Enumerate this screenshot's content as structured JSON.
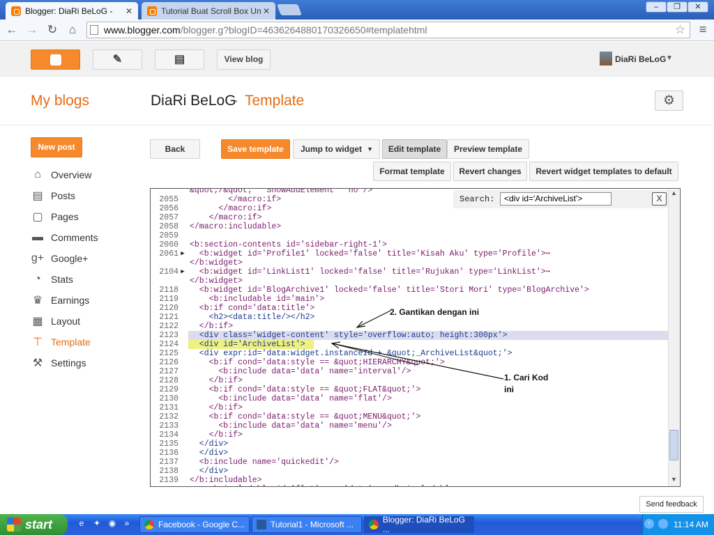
{
  "browser": {
    "tabs": [
      {
        "title": "Blogger: DiaRi BeLoG -",
        "active": true
      },
      {
        "title": "Tutorial Buat Scroll Box Untul",
        "active": false
      }
    ],
    "url_host": "www.blogger.com",
    "url_path": "/blogger.g?blogID=4636264880170326650#templatehtml",
    "window_controls": [
      "–",
      "❐",
      "✕"
    ]
  },
  "blogger_bar": {
    "view_blog": "View blog",
    "user_name": "DiaRi BeLoG"
  },
  "header": {
    "my_blogs": "My blogs",
    "blog_name": "DiaRi BeLoG",
    "separator": "·",
    "section": "Template"
  },
  "sidebar": {
    "new_post": "New post",
    "items": [
      {
        "label": "Overview",
        "icon": "home-icon",
        "glyph": "⌂"
      },
      {
        "label": "Posts",
        "icon": "posts-icon",
        "glyph": "▤"
      },
      {
        "label": "Pages",
        "icon": "pages-icon",
        "glyph": "▢"
      },
      {
        "label": "Comments",
        "icon": "comments-icon",
        "glyph": "▬"
      },
      {
        "label": "Google+",
        "icon": "google-plus-icon",
        "glyph": "g+"
      },
      {
        "label": "Stats",
        "icon": "stats-icon",
        "glyph": "◔"
      },
      {
        "label": "Earnings",
        "icon": "trophy-icon",
        "glyph": "♛"
      },
      {
        "label": "Layout",
        "icon": "layout-icon",
        "glyph": "▦"
      },
      {
        "label": "Template",
        "icon": "template-icon",
        "glyph": "⊤"
      },
      {
        "label": "Settings",
        "icon": "wrench-icon",
        "glyph": "⚒"
      }
    ]
  },
  "actions": {
    "back": "Back",
    "save": "Save template",
    "jump": "Jump to widget",
    "edit": "Edit template",
    "preview": "Preview template",
    "format": "Format template",
    "revert": "Revert changes",
    "revert_widgets": "Revert widget templates to default"
  },
  "editor": {
    "search_label": "Search:",
    "search_value": "<div id='ArchiveList'>",
    "close": "X",
    "lines": [
      {
        "n": "",
        "mark": "",
        "text": "&quot;/&quot;' 'ShowAddElement' 'no'/>"
      },
      {
        "n": "2055",
        "mark": "",
        "text": "        </macro:if>"
      },
      {
        "n": "2056",
        "mark": "",
        "text": "      </macro:if>"
      },
      {
        "n": "2057",
        "mark": "",
        "text": "    </macro:if>"
      },
      {
        "n": "2058",
        "mark": "",
        "text": "</macro:includable>"
      },
      {
        "n": "2059",
        "mark": "",
        "text": ""
      },
      {
        "n": "2060",
        "mark": "",
        "text": "<b:section-contents id='sidebar-right-1'>"
      },
      {
        "n": "2061",
        "mark": "▶",
        "text": "  <b:widget id='Profile1' locked='false' title='Kisah Aku' type='Profile'>⋯"
      },
      {
        "n": "",
        "mark": "",
        "text": "</b:widget>"
      },
      {
        "n": "2104",
        "mark": "▶",
        "text": "  <b:widget id='LinkList1' locked='false' title='Rujukan' type='LinkList'>⋯"
      },
      {
        "n": "",
        "mark": "",
        "text": "</b:widget>"
      },
      {
        "n": "2118",
        "mark": "",
        "text": "  <b:widget id='BlogArchive1' locked='false' title='Stori Mori' type='BlogArchive'>"
      },
      {
        "n": "2119",
        "mark": "",
        "text": "    <b:includable id='main'>"
      },
      {
        "n": "2120",
        "mark": "",
        "text": "  <b:if cond='data:title'>"
      },
      {
        "n": "2121",
        "mark": "",
        "text": "    <h2><data:title/></h2>"
      },
      {
        "n": "2122",
        "mark": "",
        "text": "  </b:if>"
      },
      {
        "n": "2123",
        "mark": "",
        "text": "  <div class='widget-content' style='overflow:auto; height:300px'>"
      },
      {
        "n": "2124",
        "mark": "",
        "text": "  <div id='ArchiveList'>"
      },
      {
        "n": "2125",
        "mark": "",
        "text": "  <div expr:id='data:widget.instanceId + &quot;_ArchiveList&quot;'>"
      },
      {
        "n": "2126",
        "mark": "",
        "text": "    <b:if cond='data:style == &quot;HIERARCHY&quot;'>"
      },
      {
        "n": "2127",
        "mark": "",
        "text": "      <b:include data='data' name='interval'/>"
      },
      {
        "n": "2128",
        "mark": "",
        "text": "    </b:if>"
      },
      {
        "n": "2129",
        "mark": "",
        "text": "    <b:if cond='data:style == &quot;FLAT&quot;'>"
      },
      {
        "n": "2130",
        "mark": "",
        "text": "      <b:include data='data' name='flat'/>"
      },
      {
        "n": "2131",
        "mark": "",
        "text": "    </b:if>"
      },
      {
        "n": "2132",
        "mark": "",
        "text": "    <b:if cond='data:style == &quot;MENU&quot;'>"
      },
      {
        "n": "2133",
        "mark": "",
        "text": "      <b:include data='data' name='menu'/>"
      },
      {
        "n": "2134",
        "mark": "",
        "text": "    </b:if>"
      },
      {
        "n": "2135",
        "mark": "",
        "text": "  </div>"
      },
      {
        "n": "2136",
        "mark": "",
        "text": "  </div>"
      },
      {
        "n": "2137",
        "mark": "",
        "text": "  <b:include name='quickedit'/>"
      },
      {
        "n": "2138",
        "mark": "",
        "text": "  </div>"
      },
      {
        "n": "2139",
        "mark": "",
        "text": "</b:includable>"
      },
      {
        "n": "",
        "mark": "",
        "text": "    <b:includable id='flat' var='data'>  </b:includable>"
      }
    ]
  },
  "annotations": {
    "step2": "2. Gantikan dengan ini",
    "step1_line1": "1. Cari Kod",
    "step1_line2": "ini"
  },
  "feedback": "Send feedback",
  "taskbar": {
    "start": "start",
    "tasks": [
      {
        "label": "Facebook - Google C...",
        "icon": "chrome-icon"
      },
      {
        "label": "Tutorial1 - Microsoft ...",
        "icon": "word-icon"
      },
      {
        "label": "Blogger: DiaRi BeLoG ...",
        "icon": "chrome-icon"
      }
    ],
    "clock": "11:14 AM"
  },
  "colors": {
    "accent": "#f5892b",
    "active_nav": "#e66c13",
    "taskbar": "#245edb"
  }
}
